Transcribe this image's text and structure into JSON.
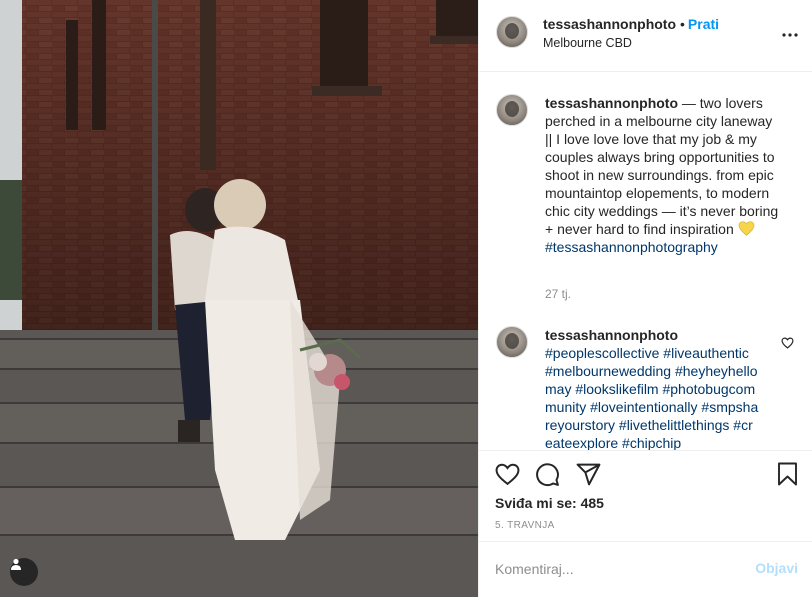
{
  "post": {
    "author": "tessashannonphoto",
    "follow_label": "Prati",
    "separator": "•",
    "location": "Melbourne CBD",
    "photo_alt": "two lovers perched in a melbourne city laneway"
  },
  "caption": {
    "username": "tessashannonphoto",
    "text": " — two lovers perched in a melbourne city laneway || I love love love that my job & my couples always bring opportunities to shoot in new surroundings. from epic mountaintop elopements, to modern chic city weddings — it’s never boring + never hard to find inspiration ",
    "hashtag": "#tessashannonphotography",
    "time": "27 tj."
  },
  "second_comment": {
    "username": "tessashannonphoto",
    "text": "#peoplescollective #liveauthentic #melbournewedding #heyheyhellomay #lookslikefilm #photobugcommunity #loveintentionally #smpshareyourstory #livethelittlethings #createexplore #chipchip"
  },
  "actions": {
    "likes_label": "Sviđa mi se: 485",
    "date": "5. TRAVNJA"
  },
  "comment_form": {
    "placeholder": "Komentiraj...",
    "submit_label": "Objavi"
  },
  "icons": {
    "like": "heart-outline-icon",
    "comment": "speech-bubble-icon",
    "share": "paper-plane-icon",
    "save": "bookmark-icon",
    "more": "ellipsis-icon",
    "tag": "user-tag-icon"
  },
  "colors": {
    "link": "#0095f6",
    "hashtag": "#00376b",
    "muted": "#8e8e8e",
    "post_disabled": "#b2dffc"
  }
}
